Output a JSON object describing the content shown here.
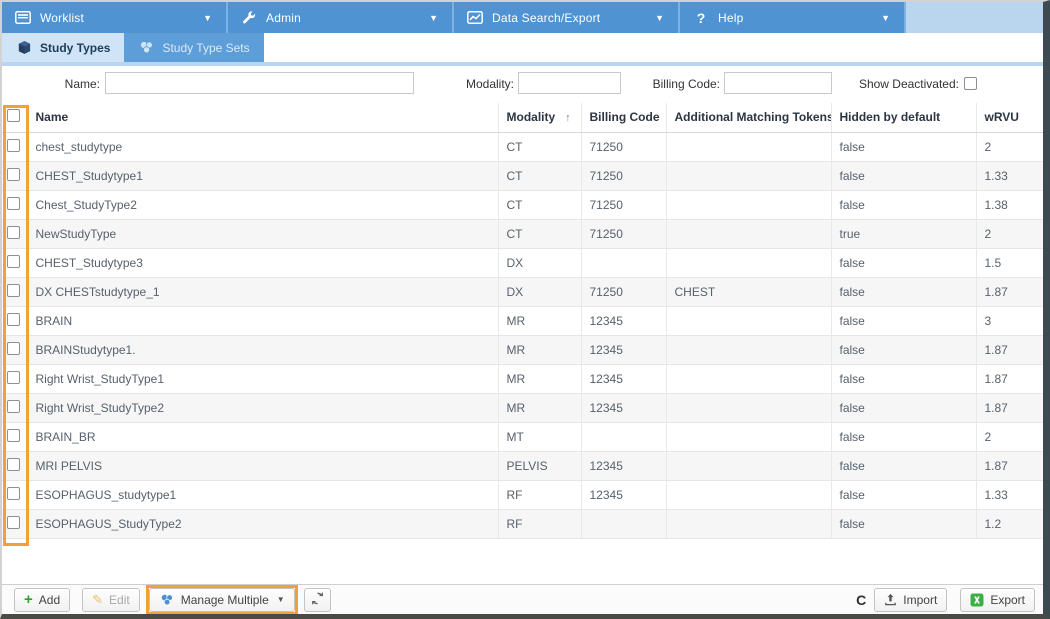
{
  "menu": {
    "items": [
      {
        "label": "Worklist",
        "icon": "worklist-icon"
      },
      {
        "label": "Admin",
        "icon": "wrench-icon"
      },
      {
        "label": "Data Search/Export",
        "icon": "chart-icon"
      },
      {
        "label": "Help",
        "icon": "help-icon"
      }
    ],
    "chevron": "▼"
  },
  "tabs": [
    {
      "label": "Study Types",
      "icon": "cube-icon",
      "active": true
    },
    {
      "label": "Study Type Sets",
      "icon": "cluster-icon",
      "active": false
    }
  ],
  "filters": {
    "name_label": "Name:",
    "name_value": "",
    "modality_label": "Modality:",
    "modality_value": "",
    "billing_label": "Billing Code:",
    "billing_value": "",
    "show_deactivated_label": "Show Deactivated:",
    "show_deactivated_checked": false
  },
  "table": {
    "columns": [
      "Name",
      "Modality",
      "Billing Code",
      "Additional Matching Tokens",
      "Hidden by default",
      "wRVU"
    ],
    "sort_column": "Modality",
    "sort_icon": "↑",
    "rows": [
      {
        "name": "chest_studytype",
        "modality": "CT",
        "billing_code": "71250",
        "tokens": "",
        "hidden_by_default": "false",
        "wrvu": "2"
      },
      {
        "name": "CHEST_Studytype1",
        "modality": "CT",
        "billing_code": "71250",
        "tokens": "",
        "hidden_by_default": "false",
        "wrvu": "1.33"
      },
      {
        "name": "Chest_StudyType2",
        "modality": "CT",
        "billing_code": "71250",
        "tokens": "",
        "hidden_by_default": "false",
        "wrvu": "1.38"
      },
      {
        "name": "NewStudyType",
        "modality": "CT",
        "billing_code": "71250",
        "tokens": "",
        "hidden_by_default": "true",
        "wrvu": "2"
      },
      {
        "name": "CHEST_Studytype3",
        "modality": "DX",
        "billing_code": "",
        "tokens": "",
        "hidden_by_default": "false",
        "wrvu": "1.5"
      },
      {
        "name": "DX CHESTstudytype_1",
        "modality": "DX",
        "billing_code": "71250",
        "tokens": "CHEST",
        "hidden_by_default": "false",
        "wrvu": "1.87"
      },
      {
        "name": "BRAIN",
        "modality": "MR",
        "billing_code": "12345",
        "tokens": "",
        "hidden_by_default": "false",
        "wrvu": "3"
      },
      {
        "name": "BRAINStudytype1.",
        "modality": "MR",
        "billing_code": "12345",
        "tokens": "",
        "hidden_by_default": "false",
        "wrvu": "1.87"
      },
      {
        "name": "Right Wrist_StudyType1",
        "modality": "MR",
        "billing_code": "12345",
        "tokens": "",
        "hidden_by_default": "false",
        "wrvu": "1.87"
      },
      {
        "name": "Right Wrist_StudyType2",
        "modality": "MR",
        "billing_code": "12345",
        "tokens": "",
        "hidden_by_default": "false",
        "wrvu": "1.87"
      },
      {
        "name": "BRAIN_BR",
        "modality": "MT",
        "billing_code": "",
        "tokens": "",
        "hidden_by_default": "false",
        "wrvu": "2"
      },
      {
        "name": "MRI PELVIS",
        "modality": "PELVIS",
        "billing_code": "12345",
        "tokens": "",
        "hidden_by_default": "false",
        "wrvu": "1.87"
      },
      {
        "name": "ESOPHAGUS_studytype1",
        "modality": "RF",
        "billing_code": "12345",
        "tokens": "",
        "hidden_by_default": "false",
        "wrvu": "1.33"
      },
      {
        "name": "ESOPHAGUS_StudyType2",
        "modality": "RF",
        "billing_code": "",
        "tokens": "",
        "hidden_by_default": "false",
        "wrvu": "1.2"
      }
    ]
  },
  "toolbar": {
    "add_label": "Add",
    "edit_label": "Edit",
    "manage_multiple_label": "Manage Multiple",
    "manage_chevron": "▼",
    "refresh_icon": "refresh-icon",
    "partial_glyph": "C",
    "import_label": "Import",
    "export_label": "Export"
  },
  "colors": {
    "menu_blue": "#4f93d2",
    "menu_filler": "#b9d6ee",
    "active_tab": "#cfe4f6",
    "inactive_tab": "#5d9ed8",
    "annotation_orange": "#f2a13a",
    "row_stripe": "#f6f6f6",
    "excel_green": "#3fae49"
  },
  "annotations": {
    "checkbox_column_highlight": true,
    "manage_multiple_highlight": true
  }
}
